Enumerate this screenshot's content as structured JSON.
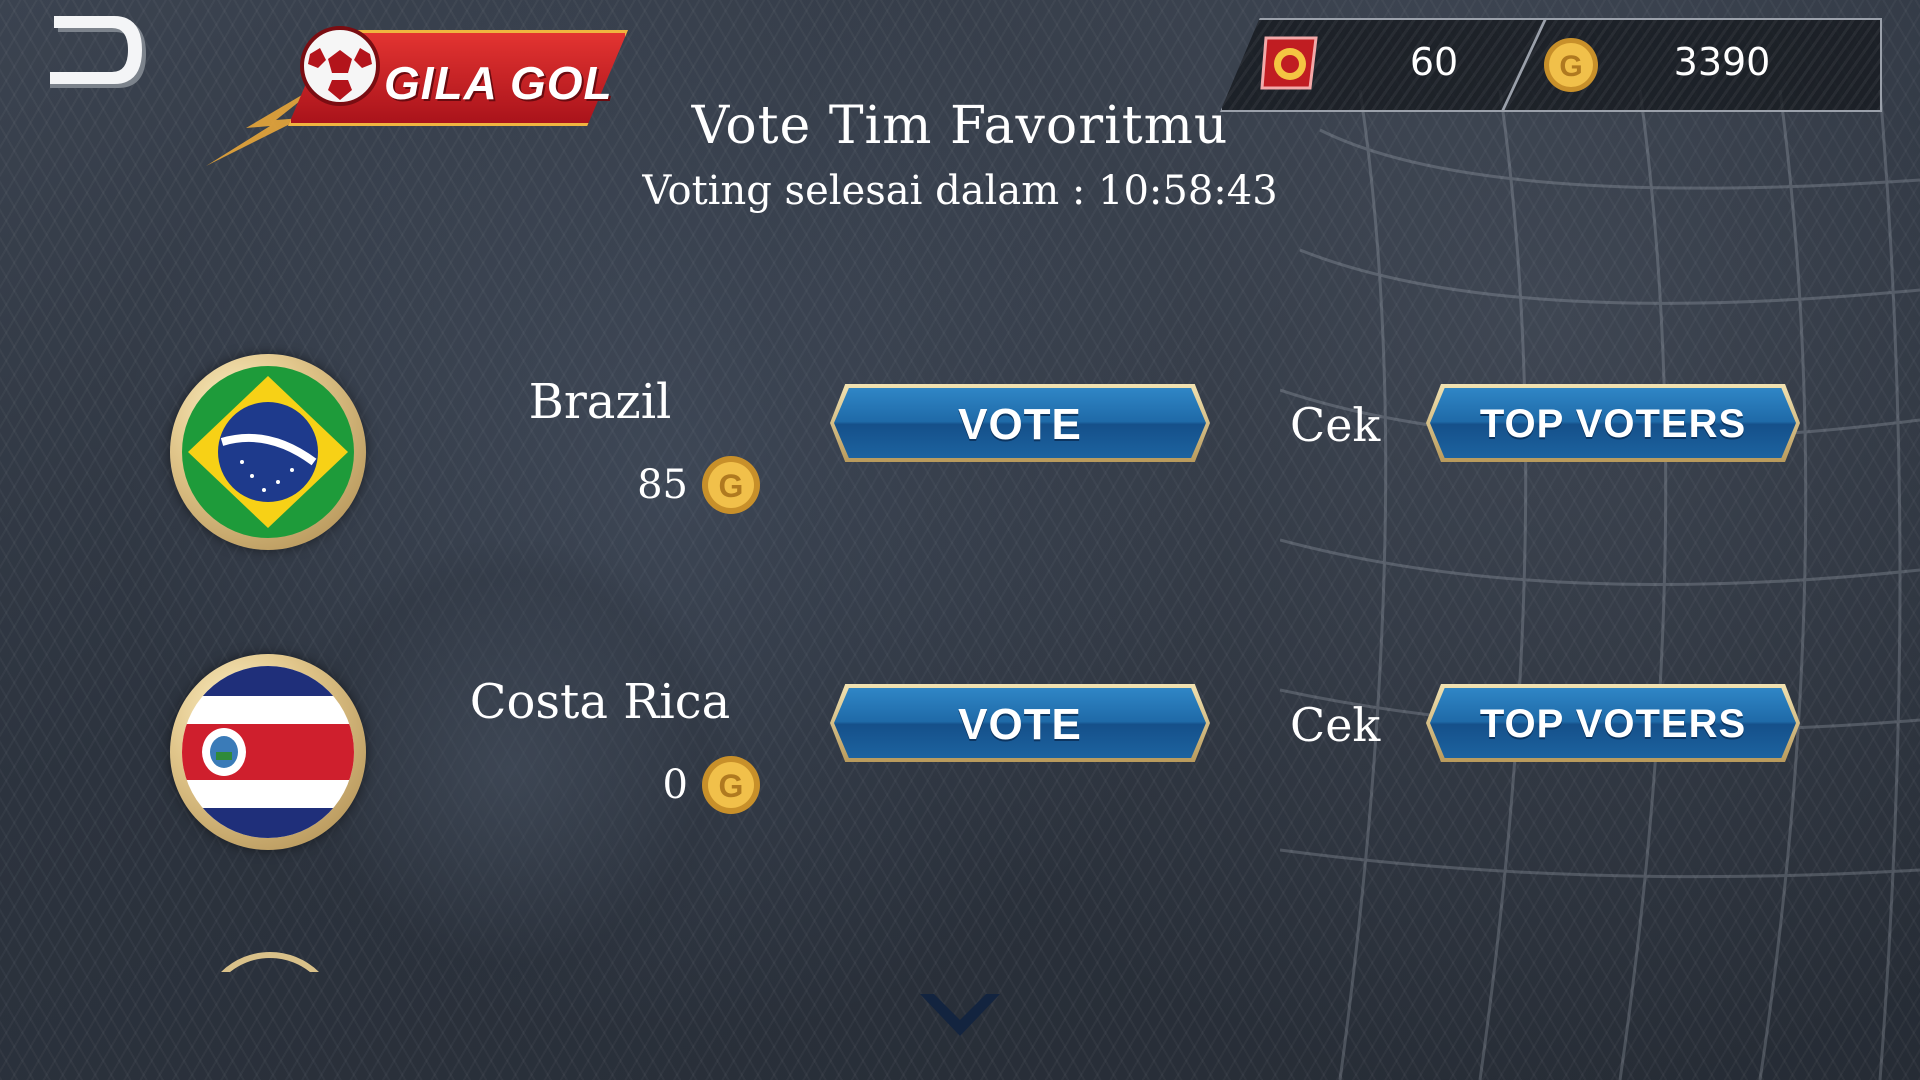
{
  "app": {
    "logo_text": "GILA GOL",
    "accent_color": "#d22a2d",
    "button_color": "#1f6aa8",
    "gold_color": "#d9a530"
  },
  "header": {
    "back_icon": "back-arrow-icon",
    "ticket_icon": "ticket-ball-icon",
    "ticket_value": "60",
    "gold_icon": "gold-coin-icon",
    "gold_value": "3390"
  },
  "main": {
    "title": "Vote Tim Favoritmu",
    "countdown": "Voting selesai dalam : 10:58:43"
  },
  "teams": [
    {
      "name": "Brazil",
      "votes": "85",
      "flag_icon": "brazil-flag-icon",
      "vote_label": "VOTE",
      "check_label": "Cek",
      "top_voters_label": "TOP VOTERS"
    },
    {
      "name": "Costa Rica",
      "votes": "0",
      "flag_icon": "costa-rica-flag-icon",
      "vote_label": "VOTE",
      "check_label": "Cek",
      "top_voters_label": "TOP VOTERS"
    }
  ],
  "footer": {
    "scroll_icon": "chevron-down-icon"
  }
}
